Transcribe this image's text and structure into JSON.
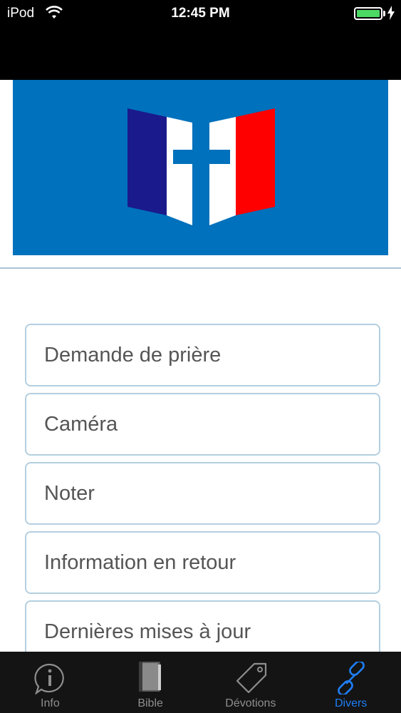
{
  "status_bar": {
    "carrier": "iPod",
    "time": "12:45 PM",
    "battery_level": 1.0
  },
  "banner": {
    "background": "#0071bc",
    "flag_colors": [
      "#1a1a8c",
      "#ffffff",
      "#ff0000"
    ]
  },
  "menu": {
    "items": [
      {
        "label": "Demande de prière"
      },
      {
        "label": "Caméra"
      },
      {
        "label": "Noter"
      },
      {
        "label": "Information en retour"
      },
      {
        "label": "Dernières mises à jour"
      }
    ]
  },
  "tabs": [
    {
      "label": "Info",
      "icon": "info-icon",
      "active": false
    },
    {
      "label": "Bible",
      "icon": "book-icon",
      "active": false
    },
    {
      "label": "Dévotions",
      "icon": "tag-icon",
      "active": false
    },
    {
      "label": "Divers",
      "icon": "link-icon",
      "active": true
    }
  ],
  "colors": {
    "accent": "#1f7ef5",
    "inactive_tab": "#8e8e8e",
    "border": "#b4cfe0"
  }
}
